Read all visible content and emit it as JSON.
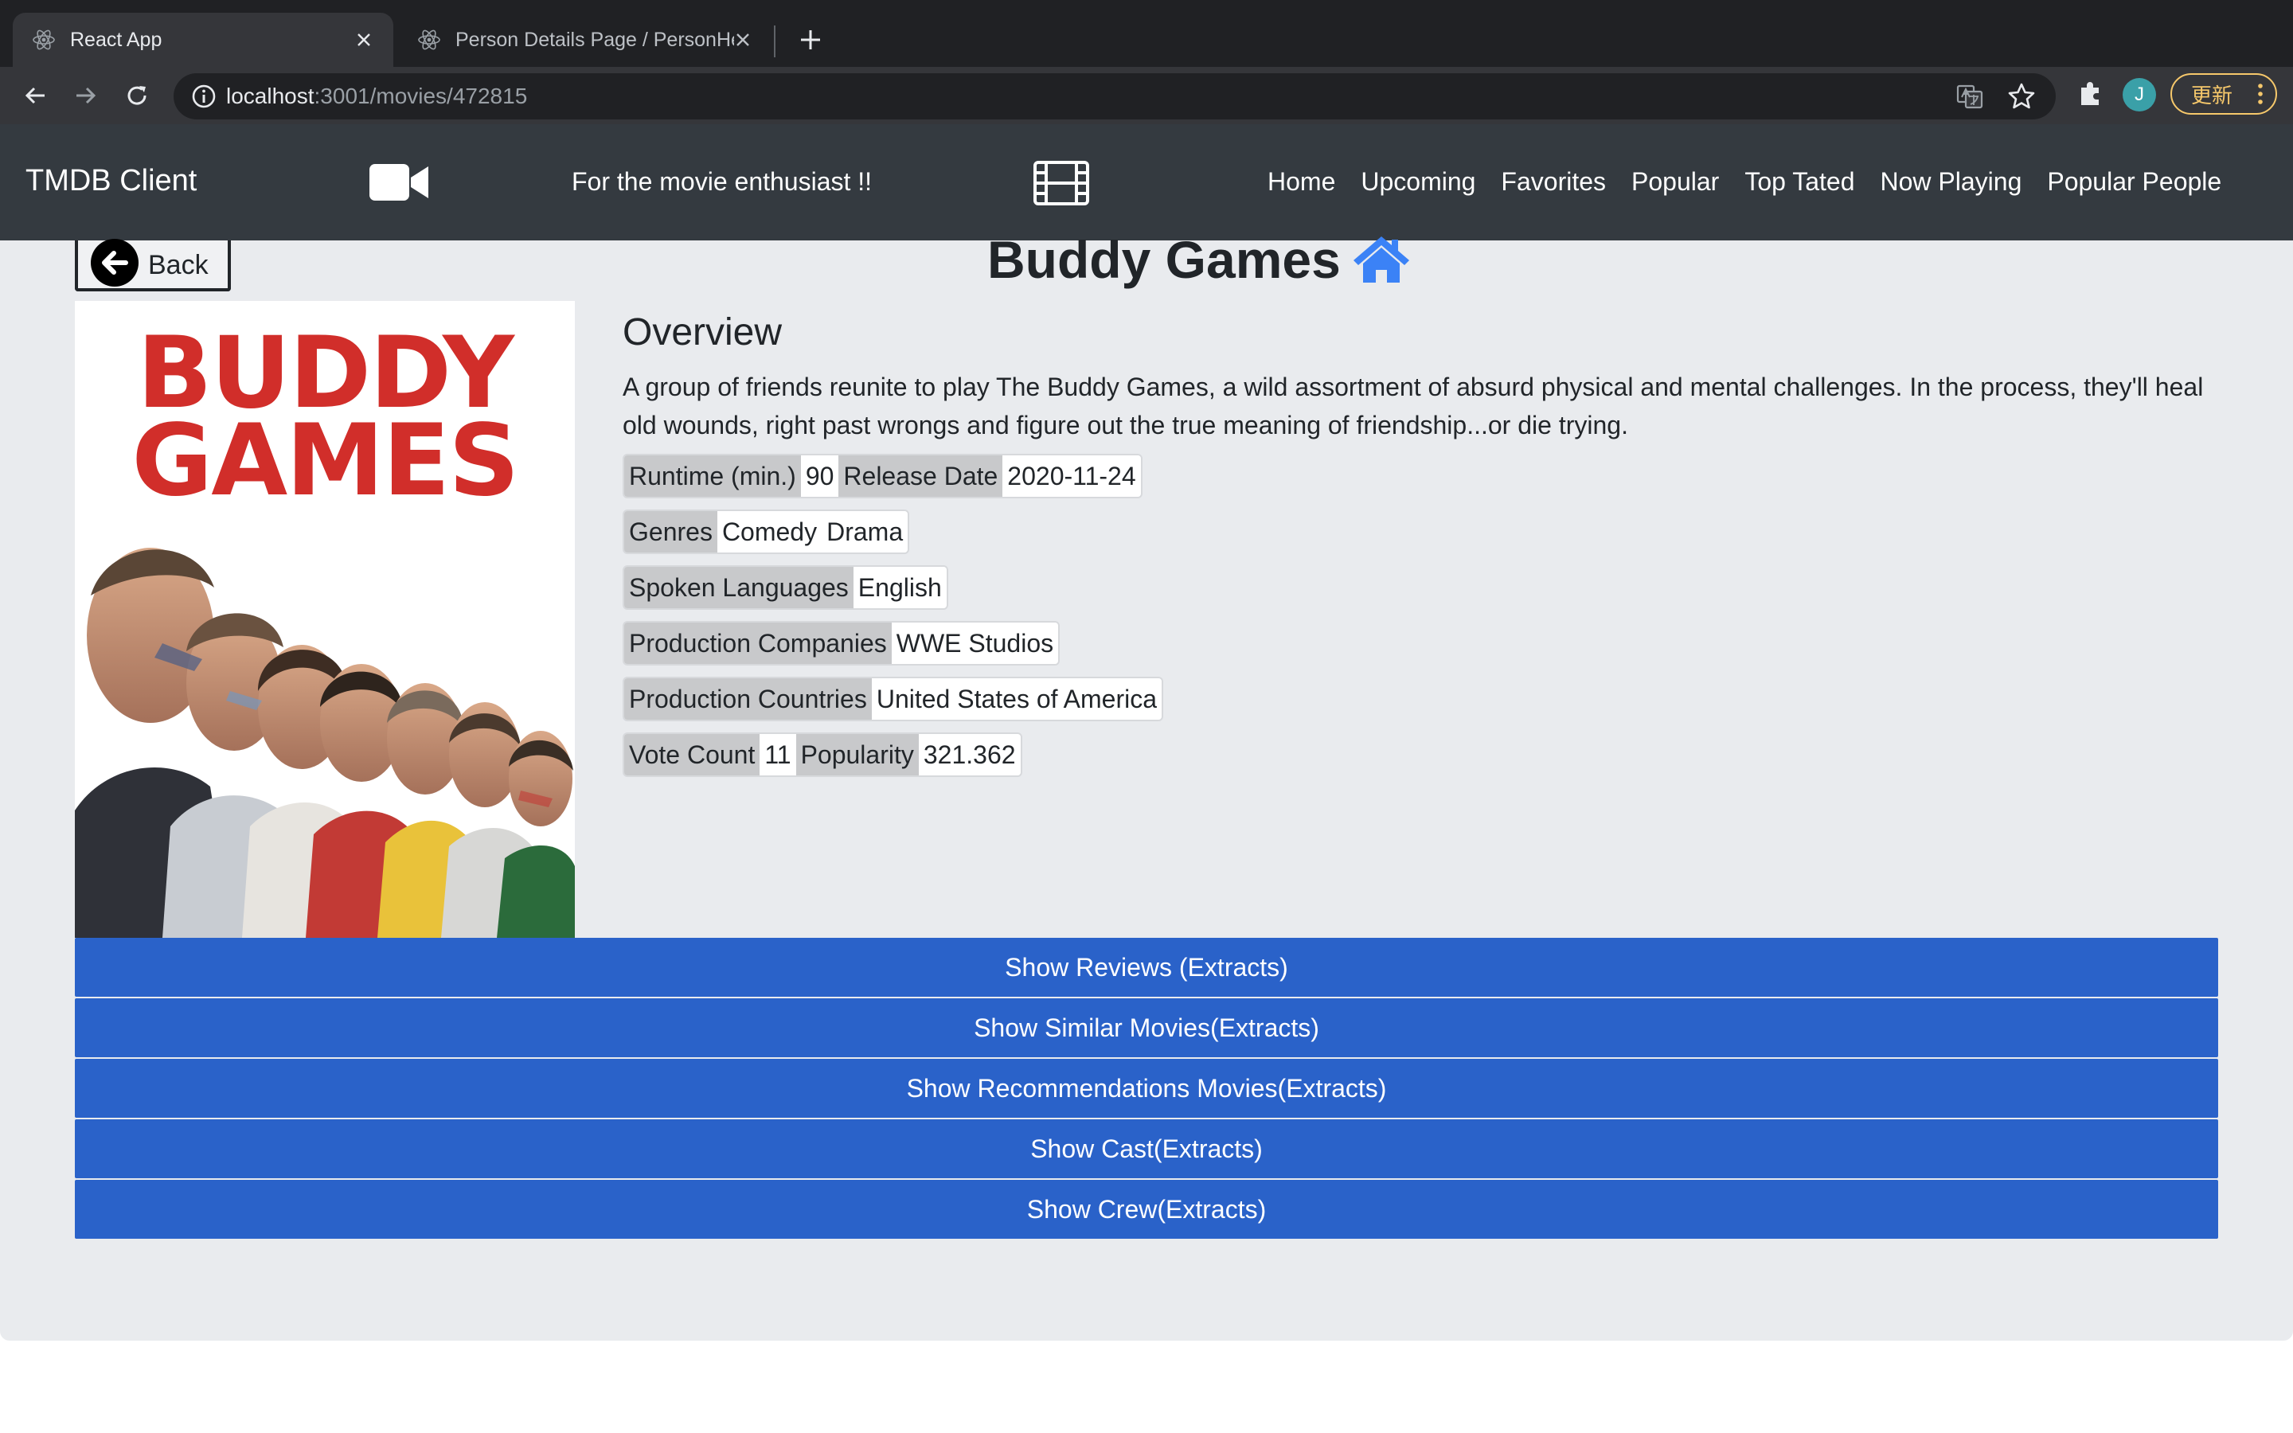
{
  "browser": {
    "tabs": [
      {
        "title": "React App",
        "active": true
      },
      {
        "title": "Person Details Page / PersonHe",
        "active": false
      }
    ],
    "url_host": "localhost",
    "url_rest": ":3001/movies/472815",
    "avatar_letter": "J",
    "update_label": "更新"
  },
  "navbar": {
    "brand": "TMDB Client",
    "tagline": "For the movie enthusiast !!",
    "links": [
      "Home",
      "Upcoming",
      "Favorites",
      "Popular",
      "Top Tated",
      "Now Playing",
      "Popular People"
    ]
  },
  "movie": {
    "back_label": "Back",
    "title": "Buddy Games",
    "poster_title_line1": "BUDDY",
    "poster_title_line2": "GAMES",
    "overview_heading": "Overview",
    "overview": "A group of friends reunite to play The Buddy Games, a wild assortment of absurd physical and mental challenges. In the process, they'll heal old wounds, right past wrongs and figure out the true meaning of friendship...or die trying.",
    "details": [
      [
        {
          "k": "Runtime (min.)",
          "v": "90"
        },
        {
          "k": "Release Date",
          "v": "2020-11-24"
        }
      ],
      [
        {
          "k": "Genres",
          "v": "Comedy"
        },
        {
          "v": "Drama"
        }
      ],
      [
        {
          "k": "Spoken Languages",
          "v": "English"
        }
      ],
      [
        {
          "k": "Production Companies",
          "v": "WWE Studios"
        }
      ],
      [
        {
          "k": "Production Countries",
          "v": "United States of America"
        }
      ],
      [
        {
          "k": "Vote Count",
          "v": "11"
        },
        {
          "k": "Popularity",
          "v": "321.362"
        }
      ]
    ],
    "actions": [
      "Show Reviews (Extracts)",
      "Show Similar Movies(Extracts)",
      "Show Recommendations Movies(Extracts)",
      "Show Cast(Extracts)",
      "Show Crew(Extracts)"
    ]
  },
  "colors": {
    "navbar_bg": "#343a40",
    "page_bg": "#e9ebee",
    "primary_button": "#2a62c9",
    "home_icon": "#3b82f6",
    "poster_red": "#d12e2a"
  }
}
